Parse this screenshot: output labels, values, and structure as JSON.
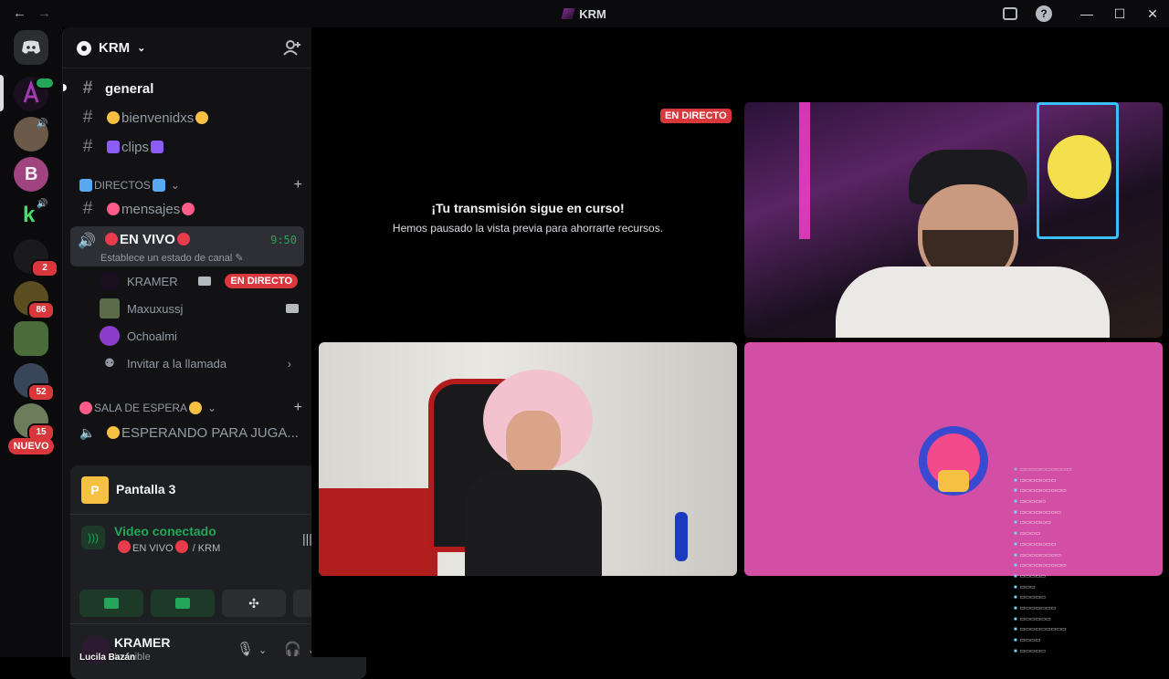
{
  "window": {
    "title": "KRM",
    "nav_back": "←",
    "nav_forward": "→",
    "minimize": "—",
    "maximize": "☐",
    "close": "✕"
  },
  "servers": {
    "badges": [
      "2",
      "86",
      "52",
      "15"
    ],
    "new_label": "NUEVO"
  },
  "guild": {
    "name": "KRM"
  },
  "channels": {
    "general": "general",
    "bienvenidxs": "bienvenidxs",
    "clips": "clips",
    "cat_directos": "DIRECTOS",
    "mensajes": "mensajes",
    "voice_name": "EN VIVO",
    "voice_timer": "9:50",
    "voice_status": "Establece un estado de canal",
    "users": [
      {
        "name": "KRAMER",
        "live": "EN DIRECTO"
      },
      {
        "name": "Maxuxussj"
      },
      {
        "name": "Ochoalmi"
      }
    ],
    "invite": "Invitar a la llamada",
    "cat_sala": "SALA DE ESPERA",
    "esperando": "ESPERANDO PARA JUGA..."
  },
  "stream_panel": {
    "title": "Pantalla 3",
    "icon_letter": "P"
  },
  "voice_panel": {
    "status": "Video conectado",
    "channel_prefix": "EN VIVO",
    "channel_suffix": "/ KRM"
  },
  "user_panel": {
    "name": "KRAMER",
    "status": "Invisible",
    "overlay_name": "Lucila Bazán"
  },
  "stage": {
    "live_label": "EN DIRECTO",
    "paused_title": "¡Tu transmisión sigue en curso!",
    "paused_sub": "Hemos pausado la vista previa para ahorrarte recursos."
  },
  "colors": {
    "accent_green": "#23a55a",
    "live_red": "#da373c",
    "bg": "#121214"
  },
  "icons": [
    "discord-icon",
    "speaker-icon",
    "camera-icon",
    "gear-icon",
    "headphones-icon",
    "microphone-icon",
    "add-member-icon",
    "hangup-icon",
    "soundboard-icon",
    "activity-icon",
    "signal-icon"
  ]
}
